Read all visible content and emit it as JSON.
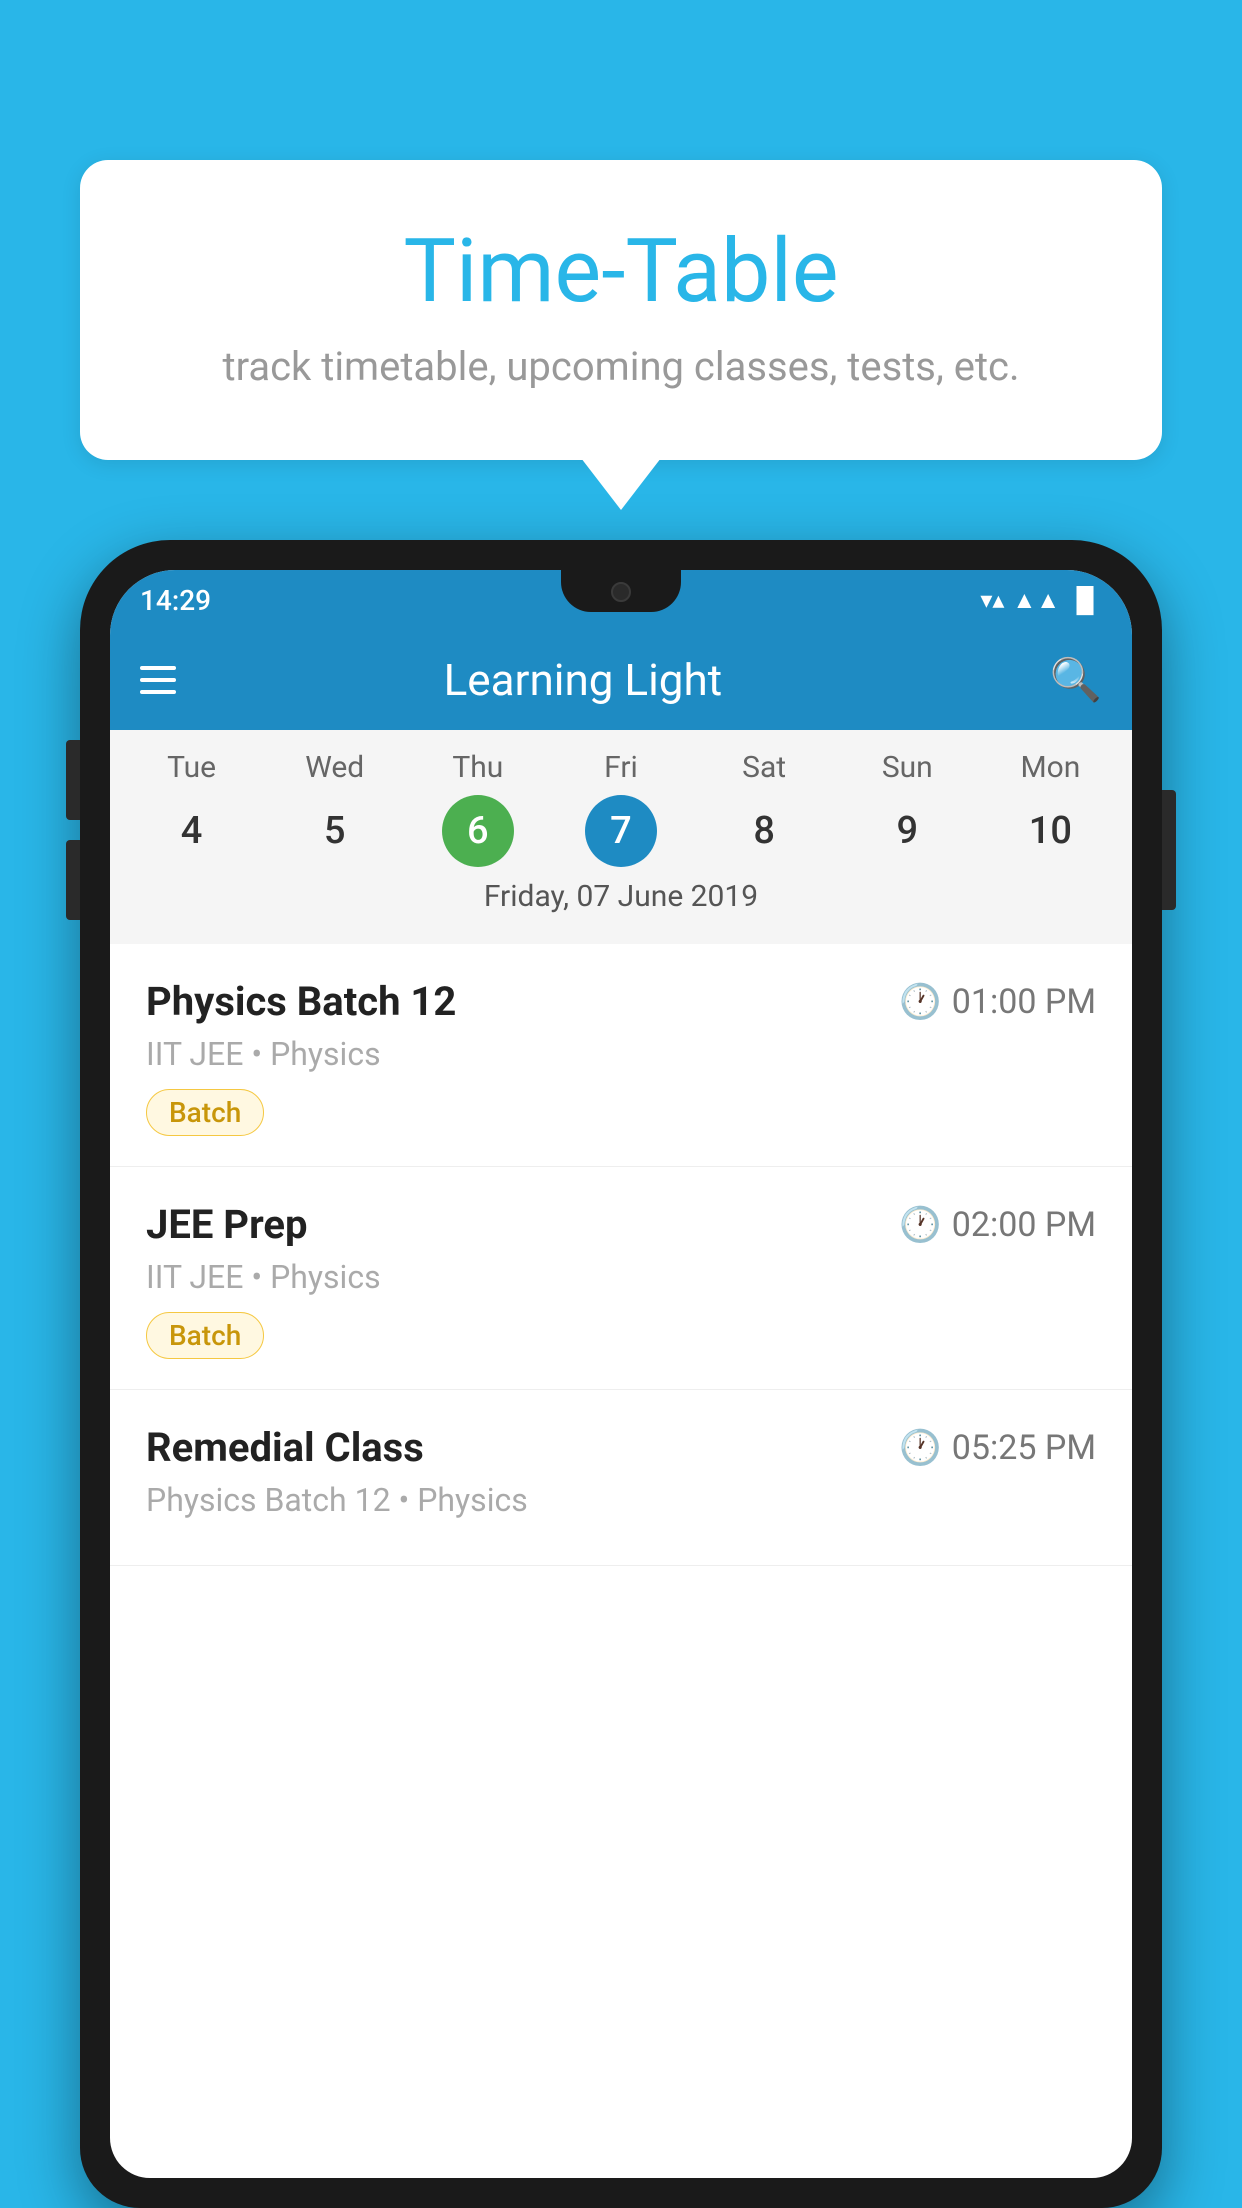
{
  "background_color": "#29b6e8",
  "speech_bubble": {
    "title": "Time-Table",
    "subtitle": "track timetable, upcoming classes, tests, etc."
  },
  "phone": {
    "status_bar": {
      "time": "14:29",
      "wifi": "▼",
      "signal": "▲",
      "battery": "▐"
    },
    "app_bar": {
      "title": "Learning Light",
      "menu_icon": "≡",
      "search_icon": "⌕"
    },
    "calendar": {
      "days": [
        {
          "name": "Tue",
          "num": "4",
          "state": "normal"
        },
        {
          "name": "Wed",
          "num": "5",
          "state": "normal"
        },
        {
          "name": "Thu",
          "num": "6",
          "state": "today"
        },
        {
          "name": "Fri",
          "num": "7",
          "state": "selected"
        },
        {
          "name": "Sat",
          "num": "8",
          "state": "normal"
        },
        {
          "name": "Sun",
          "num": "9",
          "state": "normal"
        },
        {
          "name": "Mon",
          "num": "10",
          "state": "normal"
        }
      ],
      "selected_date_label": "Friday, 07 June 2019"
    },
    "schedule": [
      {
        "name": "Physics Batch 12",
        "time": "01:00 PM",
        "sub": "IIT JEE • Physics",
        "tag": "Batch"
      },
      {
        "name": "JEE Prep",
        "time": "02:00 PM",
        "sub": "IIT JEE • Physics",
        "tag": "Batch"
      },
      {
        "name": "Remedial Class",
        "time": "05:25 PM",
        "sub": "Physics Batch 12 • Physics",
        "tag": null
      }
    ]
  }
}
